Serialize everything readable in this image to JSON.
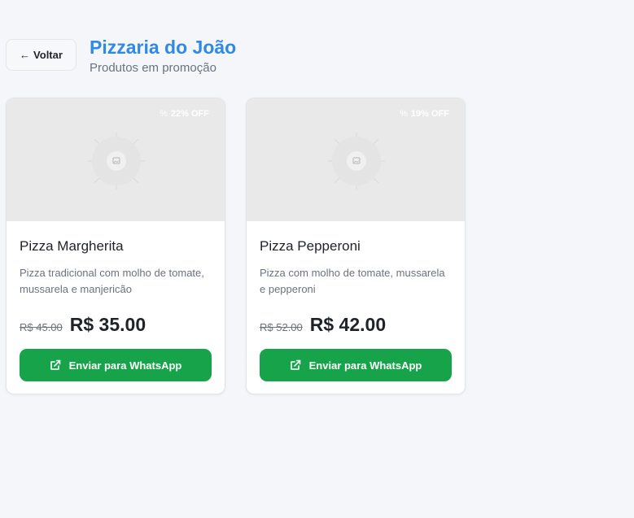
{
  "header": {
    "back_label": "Voltar",
    "title": "Pizzaria do João",
    "subtitle": "Produtos em promoção"
  },
  "products": [
    {
      "name": "Pizza Margherita",
      "description": "Pizza tradicional com molho de tomate, mussarela e manjericão",
      "old_price": "R$ 45.00",
      "new_price": "R$ 35.00",
      "discount": "22% OFF",
      "button_label": "Enviar para WhatsApp"
    },
    {
      "name": "Pizza Pepperoni",
      "description": "Pizza com molho de tomate, mussarela e pepperoni",
      "old_price": "R$ 52.00",
      "new_price": "R$ 42.00",
      "discount": "19% OFF",
      "button_label": "Enviar para WhatsApp"
    }
  ],
  "icons": {
    "back": "arrow-left-icon",
    "discount": "percent-icon",
    "image": "image-placeholder-icon",
    "send": "external-link-icon"
  },
  "colors": {
    "title": "#2f8ae5",
    "whatsapp_button": "#16a34a",
    "background": "#f4f6f9"
  }
}
